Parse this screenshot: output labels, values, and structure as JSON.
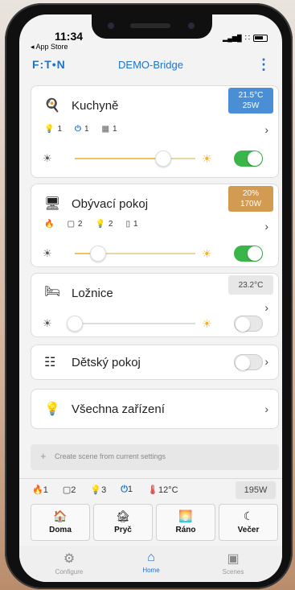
{
  "status": {
    "time": "11:34",
    "back": "◂ App Store",
    "signal": "▂▄▆█",
    "wifi": "∷"
  },
  "header": {
    "logo": "F:T•N",
    "title": "DEMO-Bridge",
    "menu": "⋮"
  },
  "rooms": [
    {
      "name": "Kuchyně",
      "icon": "pan-icon",
      "badge_line1": "21.5°C",
      "badge_line2": "25W",
      "stats": [
        "1",
        "1",
        "1"
      ],
      "dimmer_level": 0.73,
      "switch_on": true
    },
    {
      "name": "Obývací pokoj",
      "icon": "tv-icon",
      "badge_line1": "20%",
      "badge_line2": "170W",
      "stats": [
        "2",
        "2",
        "1"
      ],
      "dimmer_level": 0.19,
      "switch_on": true
    },
    {
      "name": "Ložnice",
      "icon": "bed-icon",
      "badge_line1": "23.2°C",
      "dimmer_level": 0.0,
      "switch_on": false
    },
    {
      "name": "Dětský pokoj",
      "icon": "bunkbed-icon",
      "switch_on": false
    },
    {
      "name": "Všechna zařízení",
      "icon": "bulb-icon"
    }
  ],
  "scene": {
    "label": "Create scene from current settings"
  },
  "summary": {
    "flame": "1",
    "window": "2",
    "bulb": "3",
    "power": "1",
    "temp": "12°C",
    "watt": "195W"
  },
  "modes": [
    "Doma",
    "Pryč",
    "Ráno",
    "Večer"
  ],
  "tabs": [
    "Configure",
    "Home",
    "Scenes"
  ],
  "colors": {
    "accent": "#1f73c9",
    "toggle_on": "#3ab54a",
    "badge_temp": "#4a8fd6",
    "badge_power": "#d39a52"
  }
}
